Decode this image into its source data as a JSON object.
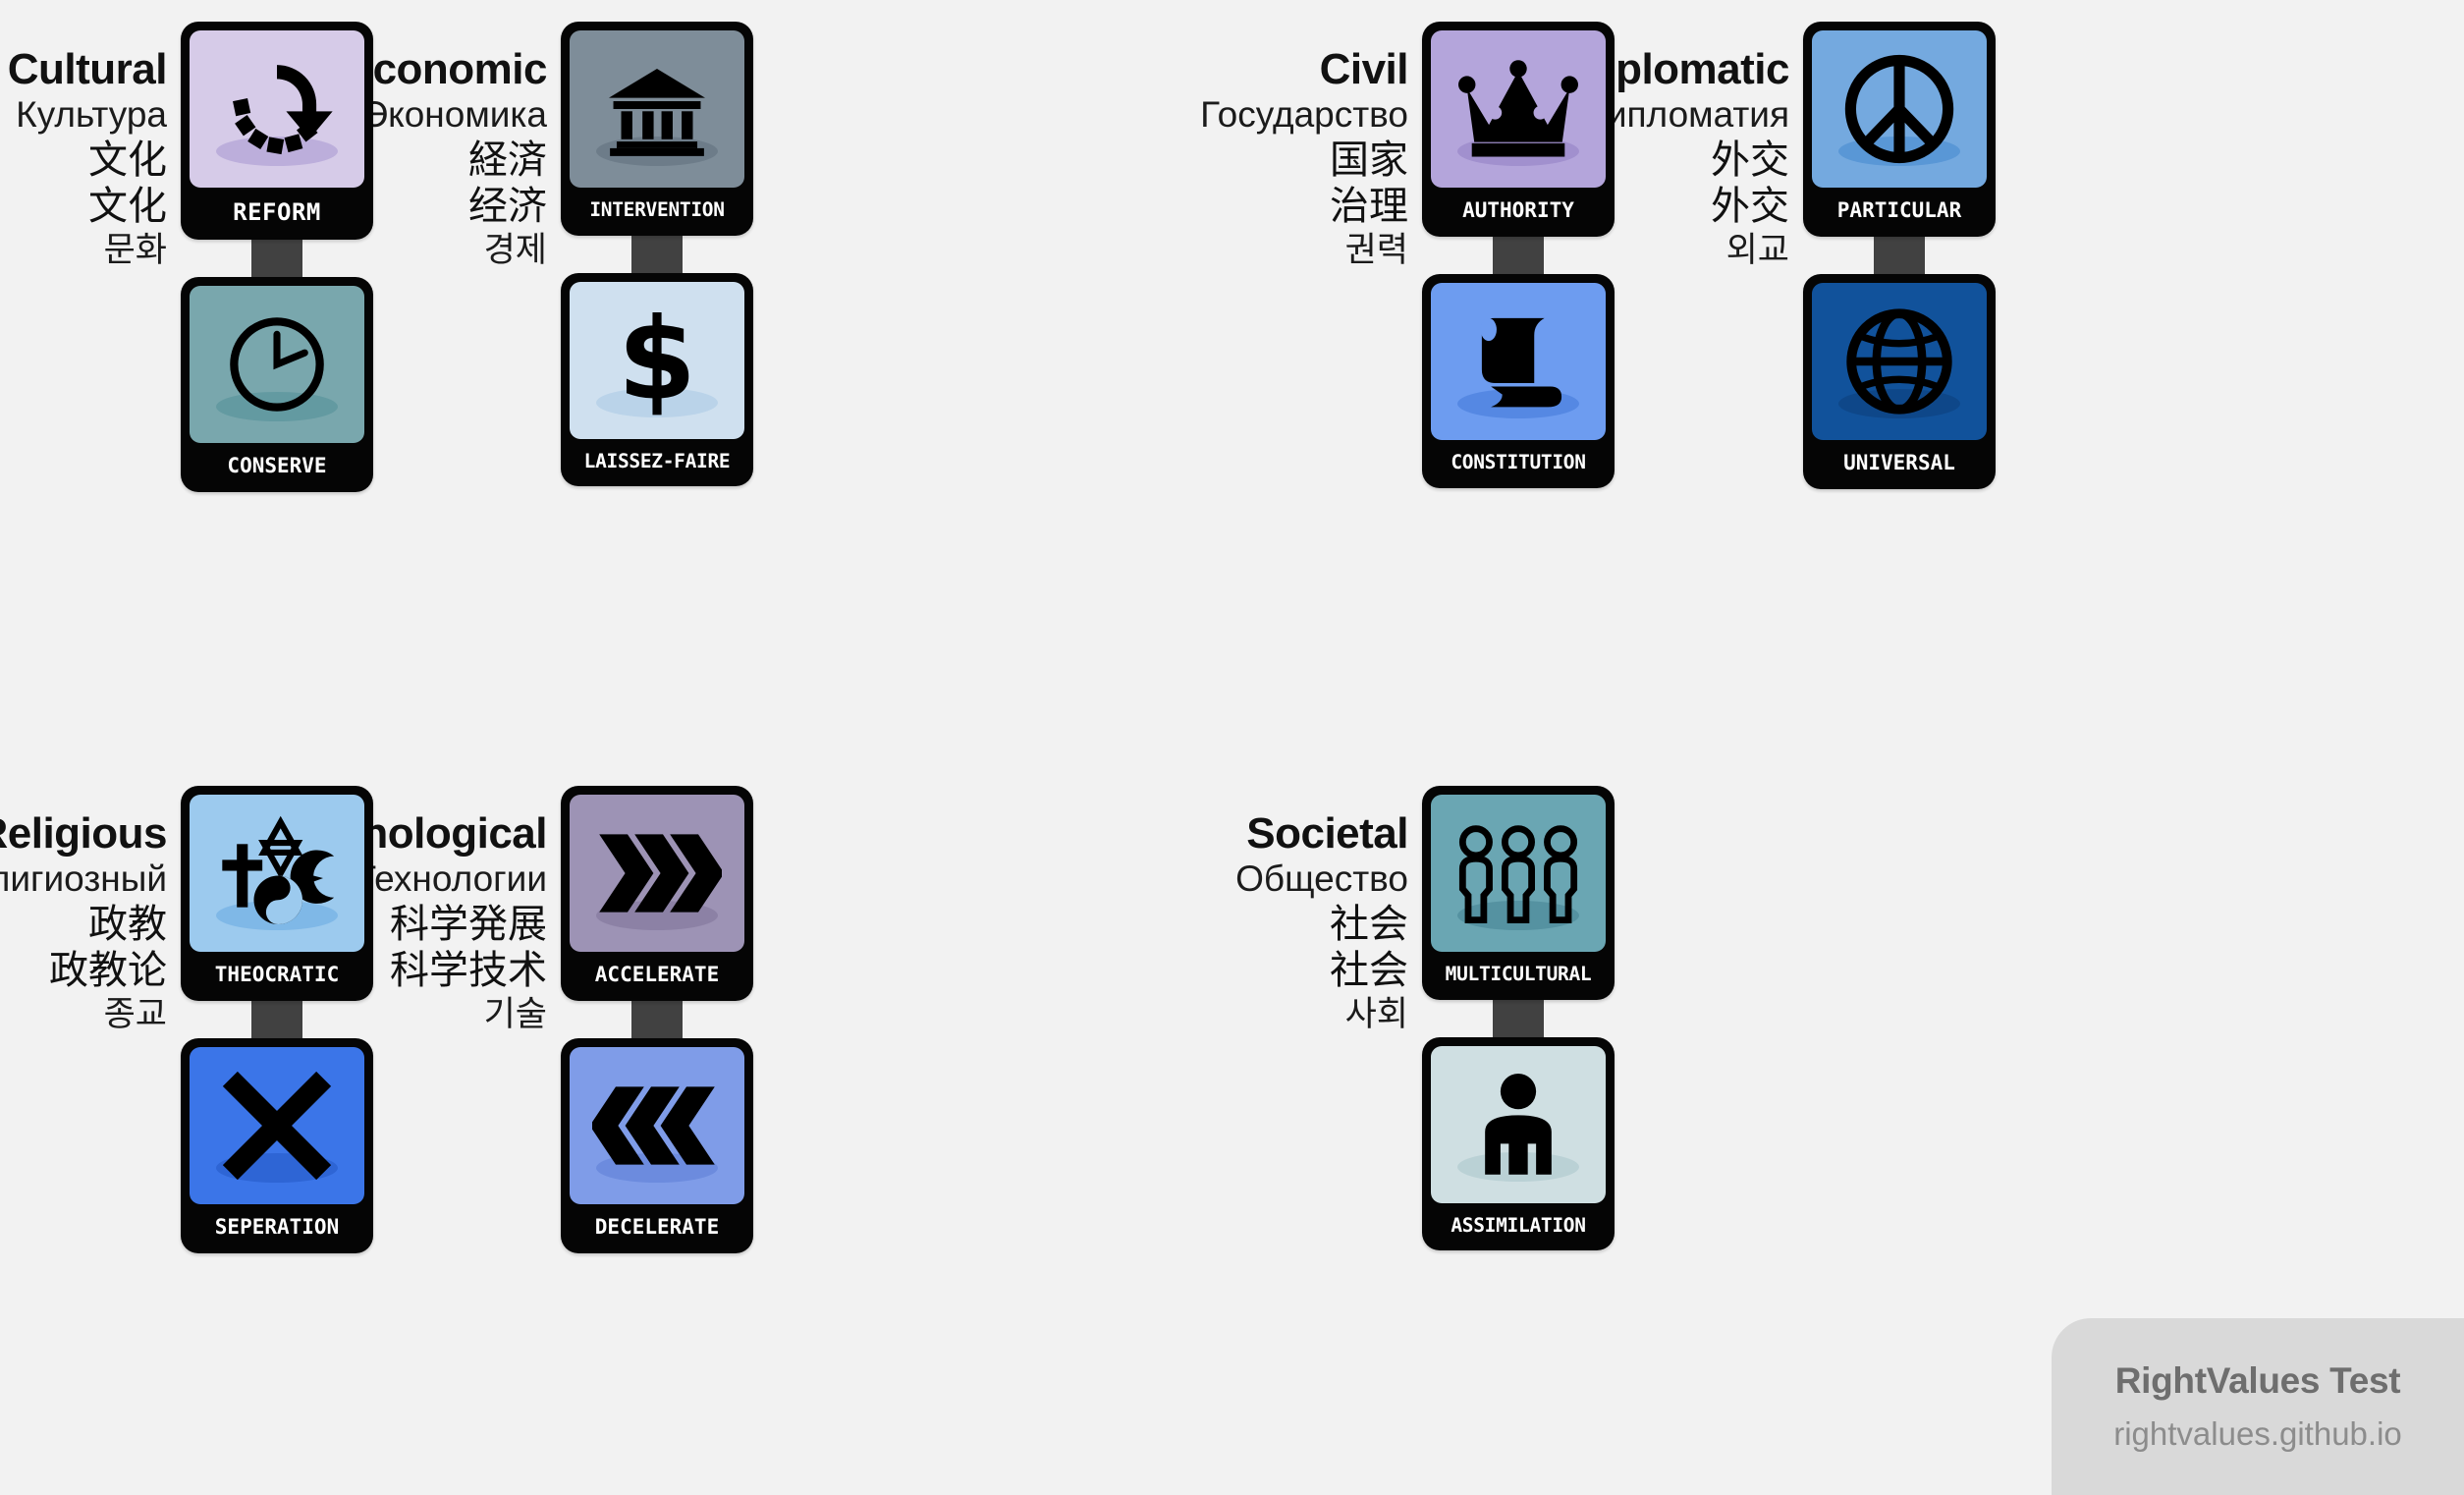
{
  "background_color": "#f2f2f2",
  "sign_frame_color": "#050505",
  "post_color": "#414141",
  "label_text_color": "#ffffff",
  "watermark": {
    "title": "RightValues Test",
    "url": "rightvalues.github.io",
    "panel_color": "#d9d9d9",
    "title_color": "#6e6e6e",
    "url_color": "#8c8c8c"
  },
  "axes": [
    {
      "key": "cultural",
      "labels": {
        "en": "Cultural",
        "ru": "Культура",
        "ja": "文化",
        "zh": "文化",
        "ko": "문화"
      },
      "top": {
        "label": "REFORM",
        "icon": "refresh-arrow-icon",
        "face_color": "#d6cbe8",
        "ground_color": "#a593cf"
      },
      "bottom": {
        "label": "CONSERVE",
        "icon": "clock-icon",
        "face_color": "#79a7ad",
        "ground_color": "#4e8d96"
      }
    },
    {
      "key": "economic",
      "labels": {
        "en": "Economic",
        "ru": "Экономика",
        "ja": "経済",
        "zh": "经济",
        "ko": "경제"
      },
      "top": {
        "label": "INTERVENTION",
        "icon": "bank-building-icon",
        "face_color": "#7e8d99",
        "ground_color": "#5d6e7b"
      },
      "bottom": {
        "label": "LAISSEZ-FAIRE",
        "icon": "dollar-sign-icon",
        "face_color": "#cfe0ef",
        "ground_color": "#a6c8e4"
      }
    },
    {
      "key": "civil",
      "labels": {
        "en": "Civil",
        "ru": "Государство",
        "ja": "国家",
        "zh": "治理",
        "ko": "권력"
      },
      "top": {
        "label": "AUTHORITY",
        "icon": "crown-icon",
        "face_color": "#b4a5db",
        "ground_color": "#8f7cc2"
      },
      "bottom": {
        "label": "CONSTITUTION",
        "icon": "scroll-icon",
        "face_color": "#6d9cf0",
        "ground_color": "#3f76d6"
      }
    },
    {
      "key": "diplomatic",
      "labels": {
        "en": "Diplomatic",
        "ru": "Дипломатия",
        "ja": "外交",
        "zh": "外交",
        "ko": "외교"
      },
      "top": {
        "label": "PARTICULAR",
        "icon": "peace-sign-icon",
        "face_color": "#74a9df",
        "ground_color": "#4186cd"
      },
      "bottom": {
        "label": "UNIVERSAL",
        "icon": "globe-icon",
        "face_color": "#11529b",
        "ground_color": "#0c3e78"
      }
    },
    {
      "key": "religious",
      "labels": {
        "en": "Religious",
        "ru": "Религиозный",
        "ja": "政教",
        "zh": "政教论",
        "ko": "종교"
      },
      "top": {
        "label": "THEOCRATIC",
        "icon": "religious-symbols-icon",
        "face_color": "#9ccaee",
        "ground_color": "#66a7e0"
      },
      "bottom": {
        "label": "SEPERATION",
        "icon": "x-cross-icon",
        "face_color": "#3b75e8",
        "ground_color": "#2256c4"
      }
    },
    {
      "key": "technological",
      "labels": {
        "en": "Technological",
        "ru": "Технологии",
        "ja": "科学発展",
        "zh": "科学技术",
        "ko": "기술"
      },
      "top": {
        "label": "ACCELERATE",
        "icon": "chevrons-right-icon",
        "face_color": "#9d93b5",
        "ground_color": "#7d7198"
      },
      "bottom": {
        "label": "DECELERATE",
        "icon": "chevrons-left-icon",
        "face_color": "#7f9ce8",
        "ground_color": "#5a7cd4"
      }
    },
    {
      "key": "societal",
      "labels": {
        "en": "Societal",
        "ru": "Общество",
        "ja": "社会",
        "zh": "社会",
        "ko": "사회"
      },
      "top": {
        "label": "MULTICULTURAL",
        "icon": "three-people-icon",
        "face_color": "#6aa6b3",
        "ground_color": "#44818f"
      },
      "bottom": {
        "label": "ASSIMILATION",
        "icon": "single-person-icon",
        "face_color": "#cfdfe2",
        "ground_color": "#a7c4c9"
      }
    }
  ]
}
